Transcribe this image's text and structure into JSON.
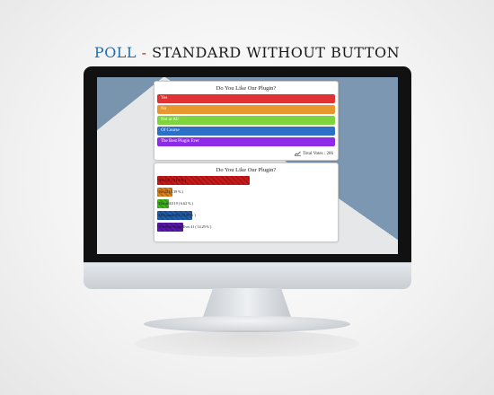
{
  "headline": {
    "poll": "POLL",
    "separator": "-",
    "rest": "STANDARD WITHOUT BUTTON"
  },
  "poll_form": {
    "question": "Do You Like Our Plugin?",
    "options": [
      {
        "label": "Yes",
        "color": "#e03232"
      },
      {
        "label": "No",
        "color": "#e8962e"
      },
      {
        "label": "Not at All",
        "color": "#7ed43c"
      },
      {
        "label": "Of Course",
        "color": "#2b70c4"
      },
      {
        "label": "The Best Plugin Ever",
        "color": "#8f2be8"
      }
    ],
    "total_votes": "Total Votes : 286"
  },
  "poll_results": {
    "question": "Do You Like Our Plugin?",
    "results": [
      {
        "label": "Yes",
        "votes": "147",
        "percent": "51.4",
        "text": "Yes   147 ( 51.4 % )",
        "color": "#cc1a1a"
      },
      {
        "label": "No",
        "votes": "24",
        "percent": "8.39",
        "text": "No   24 ( 8.39 % )",
        "color": "#e0841a"
      },
      {
        "label": "Not at All",
        "votes": "19",
        "percent": "6.62",
        "text": "Not at All   19 ( 6.62 % )",
        "color": "#3fb81f"
      },
      {
        "label": "Of Course",
        "votes": "55",
        "percent": "19.47",
        "text": "Of Course   55 ( 19.47 % )",
        "color": "#1f5fb0"
      },
      {
        "label": "The Best Plugin Ever",
        "votes": "41",
        "percent": "14.29",
        "text": "The Best Plugin Ever   41 ( 14.29 % )",
        "color": "#5a18b0"
      }
    ]
  }
}
